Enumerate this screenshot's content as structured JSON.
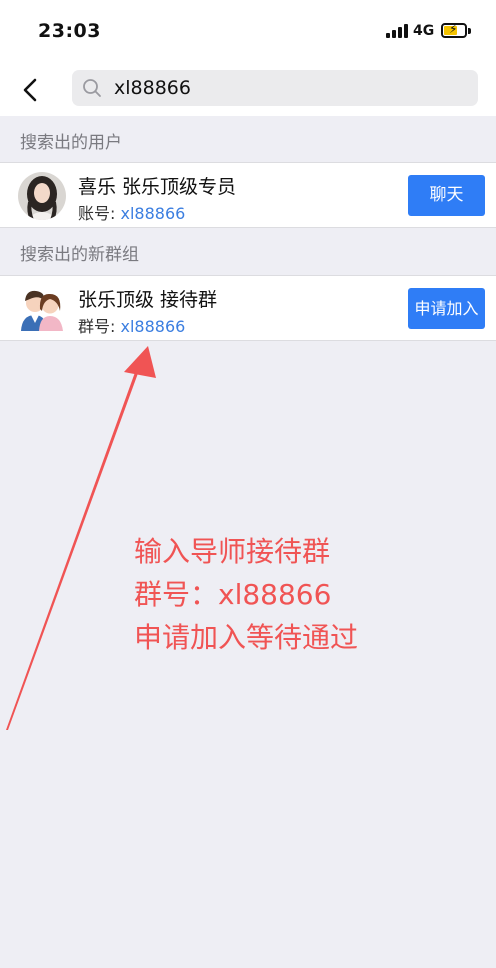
{
  "status_bar": {
    "time": "23:03",
    "network": "4G",
    "battery_color": "#f5c400"
  },
  "search": {
    "query": "xl88866"
  },
  "sections": [
    {
      "header": "搜索出的用户",
      "result": {
        "title": "喜乐 张乐顶级专员",
        "sub_label": "账号:",
        "sub_value": "xl88866",
        "button": "聊天"
      }
    },
    {
      "header": "搜索出的新群组",
      "result": {
        "title": "张乐顶级 接待群",
        "sub_label": "群号:",
        "sub_value": "xl88866",
        "button": "申请加入"
      }
    }
  ],
  "annotation": {
    "lines": [
      "输入导师接待群",
      "群号：xl88866",
      "申请加入等待通过"
    ],
    "color": "#f05454"
  },
  "colors": {
    "accent": "#2f7df6",
    "link": "#3b7ee0"
  }
}
